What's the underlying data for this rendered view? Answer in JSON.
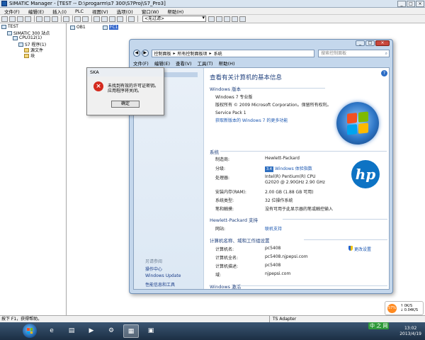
{
  "window": {
    "title": "SIMATIC Manager - [TEST -- D:\\progarm\\s7 300\\S7Proj\\S7_Pro3]",
    "controls": [
      "_",
      "□",
      "×"
    ]
  },
  "menu": [
    "文件(F)",
    "编辑(E)",
    "插入(I)",
    "PLC",
    "视图(V)",
    "选项(O)",
    "窗口(W)",
    "帮助(H)"
  ],
  "toolbar": {
    "filter_value": "<无过滤>"
  },
  "tree": {
    "root": "TEST",
    "station": "SIMATIC 300 站点",
    "cpu": "CPU312(1)",
    "program": "S7 程序(1)",
    "sources": "源文件",
    "blocks": "块"
  },
  "content": {
    "item1": "OB1",
    "selected": "FC1"
  },
  "statusbar": {
    "hint": "按下 F1，获得帮助。",
    "adapter": "TS Adapter"
  },
  "syswin": {
    "address": [
      "控制面板",
      "所有控制面板项",
      "系统"
    ],
    "search_placeholder": "搜索控制面板",
    "menu": [
      "文件(F)",
      "编辑(E)",
      "查看(V)",
      "工具(T)",
      "帮助(H)"
    ],
    "leftnav": {
      "see_also": "另请参阅",
      "links": [
        "操作中心",
        "Windows Update",
        "性能信息和工具"
      ]
    },
    "main": {
      "heading": "查看有关计算机的基本信息",
      "edition_header": "Windows 版本",
      "edition": "Windows 7 专业版",
      "copyright": "版权所有 © 2009 Microsoft Corporation。保留所有权利。",
      "service_pack": "Service Pack 1",
      "more_features": "获取新版本的 Windows 7 的更多功能",
      "system_header": "系统",
      "rows": [
        {
          "label": "制造商:",
          "value": "Hewlett-Packard"
        },
        {
          "label": "分级:",
          "value": "Windows 体验指数"
        },
        {
          "label": "处理器:",
          "value": "Intel(R) Pentium(R) CPU G2020 @ 2.90GHz   2.90 GHz"
        },
        {
          "label": "安装内存(RAM):",
          "value": "2.00 GB (1.88 GB 可用)"
        },
        {
          "label": "系统类型:",
          "value": "32 位操作系统"
        },
        {
          "label": "笔和触摸:",
          "value": "没有可用于此显示器的笔或触控输入"
        }
      ],
      "support_header": "Hewlett-Packard 支持",
      "website_label": "网站:",
      "website_value": "联机支持",
      "computer_header": "计算机名称、域和工作组设置",
      "computer_rows": [
        {
          "label": "计算机名:",
          "value": "pc5408"
        },
        {
          "label": "计算机全名:",
          "value": "pc5408.njpepsi.com"
        },
        {
          "label": "计算机描述:",
          "value": "pc5408"
        },
        {
          "label": "域:",
          "value": "njpepsi.com"
        }
      ],
      "change_settings": "更改设置",
      "activation_header": "Windows 激活"
    }
  },
  "ska_dialog": {
    "title": "SKA",
    "message_line1": "未找到有效的许可证密钥。",
    "message_line2": "应用程序将关闭。",
    "ok_label": "确定"
  },
  "netwidget": {
    "percent": "57%",
    "rate_up": "0K/S",
    "rate_down": "0.04K/S"
  },
  "taskbar": {
    "time": "13:02",
    "date": "2013/4/19",
    "brand": "中 之 网"
  }
}
